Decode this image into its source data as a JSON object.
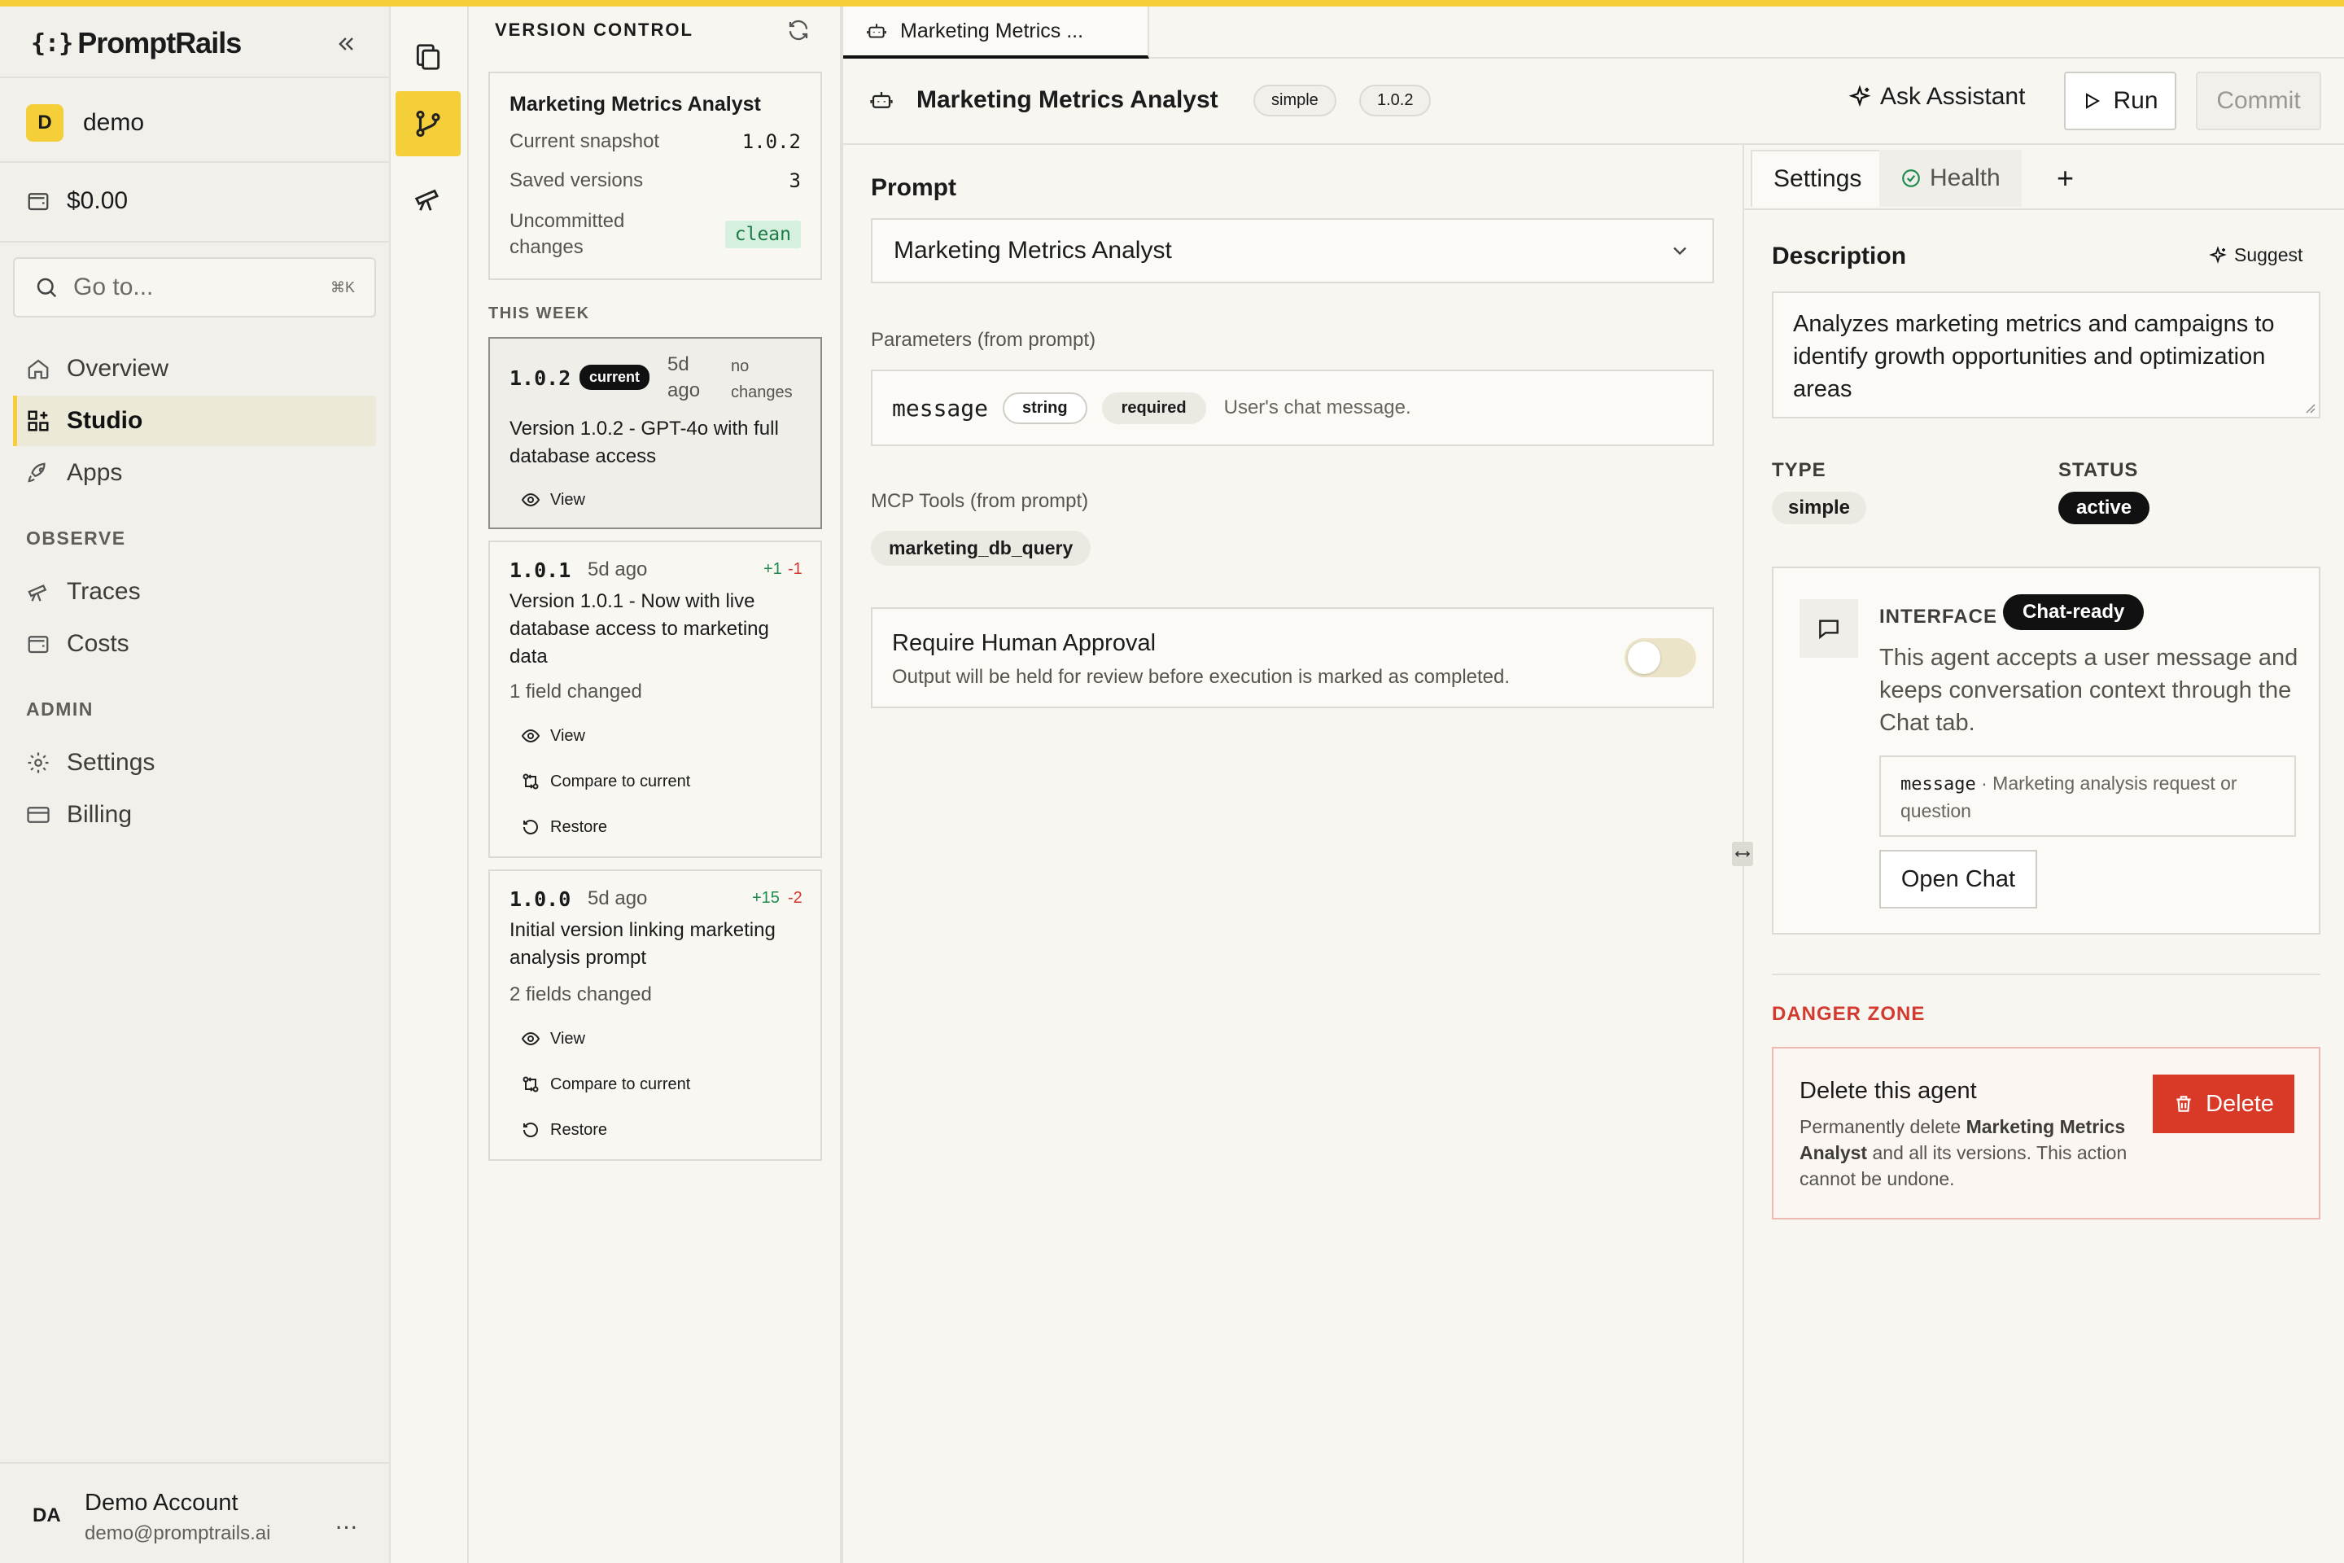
{
  "brand": {
    "logo_bracket": "{:}",
    "name": "PromptRails"
  },
  "workspace": {
    "initial": "D",
    "name": "demo"
  },
  "balance": "$0.00",
  "goto": {
    "placeholder": "Go to...",
    "shortcut": "⌘K"
  },
  "nav": {
    "overview": "Overview",
    "studio": "Studio",
    "apps": "Apps",
    "observe_heading": "OBSERVE",
    "traces": "Traces",
    "costs": "Costs",
    "admin_heading": "ADMIN",
    "settings": "Settings",
    "billing": "Billing"
  },
  "account": {
    "initials": "DA",
    "name": "Demo Account",
    "email": "demo@promptrails.ai",
    "more": "..."
  },
  "version_control": {
    "title": "VERSION CONTROL",
    "snapshot": {
      "name": "Marketing Metrics Analyst",
      "current_label": "Current snapshot",
      "current_value": "1.0.2",
      "saved_label": "Saved versions",
      "saved_value": "3",
      "uncommitted_label": "Uncommitted changes",
      "uncommitted_value": "clean"
    },
    "this_week": "THIS WEEK",
    "versions": [
      {
        "num": "1.0.2",
        "badge": "current",
        "ago": "5d ago",
        "changes": "no changes",
        "desc": "Version 1.0.2 - GPT-4o with full database access",
        "view": "View"
      },
      {
        "num": "1.0.1",
        "ago": "5d ago",
        "plus": "+1",
        "minus": "-1",
        "desc": "Version 1.0.1 - Now with live database access to marketing data",
        "changed": "1 field changed",
        "view": "View",
        "compare": "Compare to current",
        "restore": "Restore"
      },
      {
        "num": "1.0.0",
        "ago": "5d ago",
        "plus": "+15",
        "minus": "-2",
        "desc": "Initial version linking marketing analysis prompt",
        "changed": "2 fields changed",
        "view": "View",
        "compare": "Compare to current",
        "restore": "Restore"
      }
    ]
  },
  "tab": {
    "label": "Marketing Metrics ..."
  },
  "header": {
    "title": "Marketing Metrics Analyst",
    "type_pill": "simple",
    "version_pill": "1.0.2",
    "ask_assistant": "Ask Assistant",
    "run": "Run",
    "commit": "Commit"
  },
  "editor": {
    "prompt_label": "Prompt",
    "prompt_value": "Marketing Metrics Analyst",
    "params_label": "Parameters (from prompt)",
    "param": {
      "name": "message",
      "type": "string",
      "required": "required",
      "desc": "User's chat message."
    },
    "tools_label": "MCP Tools (from prompt)",
    "tool": "marketing_db_query",
    "approval_title": "Require Human Approval",
    "approval_desc": "Output will be held for review before execution is marked as completed.",
    "approval_enabled": false
  },
  "settings": {
    "tab_settings": "Settings",
    "tab_health": "Health",
    "tab_add": "+",
    "description_label": "Description",
    "suggest": "Suggest",
    "description": "Analyzes marketing metrics and campaigns to identify growth opportunities and optimization areas",
    "type_label": "TYPE",
    "type_value": "simple",
    "status_label": "STATUS",
    "status_value": "active",
    "interface_label": "INTERFACE",
    "interface_badge": "Chat-ready",
    "interface_desc": "This agent accepts a user message and keeps conversation context through the Chat tab.",
    "interface_param": "message",
    "interface_param_desc": " · Marketing analysis request or question",
    "open_chat": "Open Chat",
    "danger_label": "DANGER ZONE",
    "delete_title": "Delete this agent",
    "delete_desc_pre": "Permanently delete ",
    "delete_desc_name": "Marketing Metrics Analyst",
    "delete_desc_post": " and all its versions. This action cannot be undone.",
    "delete_button": "Delete"
  },
  "colors": {
    "accent": "#f5cf3a",
    "danger": "#d93a28",
    "success": "#1d8a4e"
  }
}
